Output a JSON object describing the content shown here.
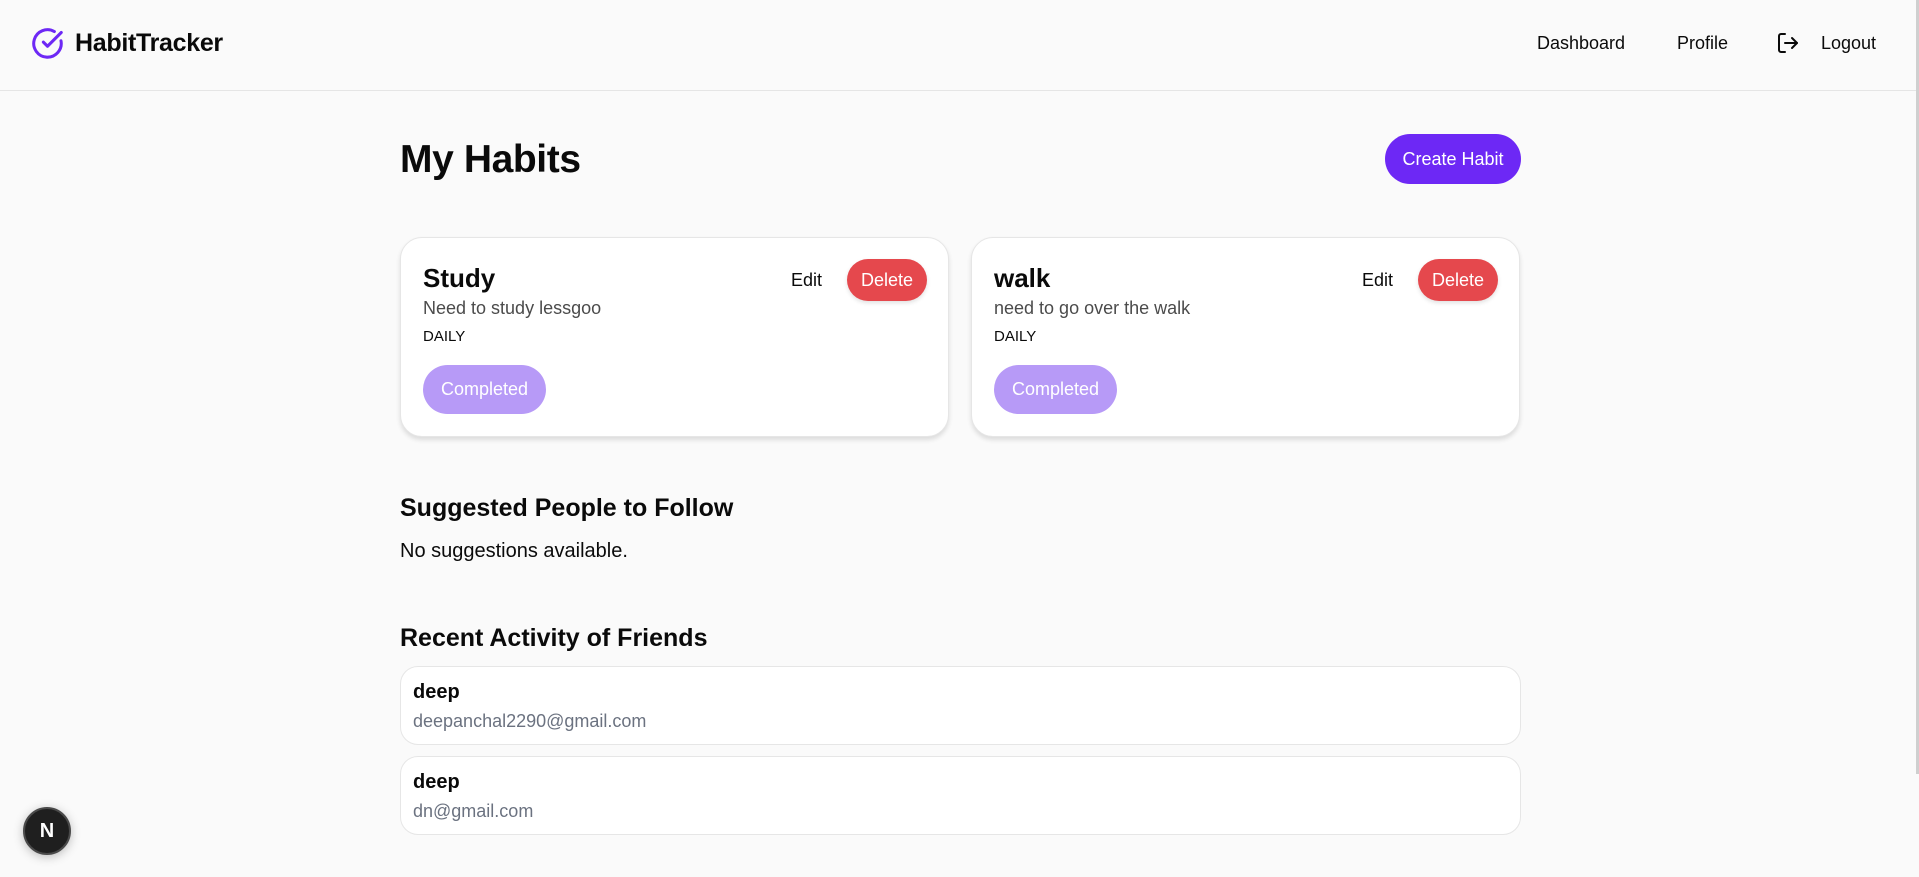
{
  "nav": {
    "brand": "HabitTracker",
    "links": {
      "dashboard": "Dashboard",
      "profile": "Profile",
      "logout": "Logout"
    },
    "brand_color": "#6d28f5"
  },
  "main": {
    "title": "My Habits",
    "create_label": "Create Habit",
    "habits": [
      {
        "name": "Study",
        "description": "Need to study lessgoo",
        "frequency": "DAILY",
        "edit_label": "Edit",
        "delete_label": "Delete",
        "status_label": "Completed"
      },
      {
        "name": "walk",
        "description": "need to go over the walk",
        "frequency": "DAILY",
        "edit_label": "Edit",
        "delete_label": "Delete",
        "status_label": "Completed"
      }
    ],
    "suggestions": {
      "title": "Suggested People to Follow",
      "empty_text": "No suggestions available."
    },
    "activity": {
      "title": "Recent Activity of Friends",
      "items": [
        {
          "name": "deep",
          "email": "deepanchal2290@gmail.com"
        },
        {
          "name": "deep",
          "email": "dn@gmail.com"
        }
      ]
    }
  },
  "dev_badge": {
    "label": "N",
    "icon": "nextjs-icon"
  },
  "colors": {
    "primary": "#6d28f5",
    "danger": "#e5484d",
    "completed": "#b79af7"
  }
}
